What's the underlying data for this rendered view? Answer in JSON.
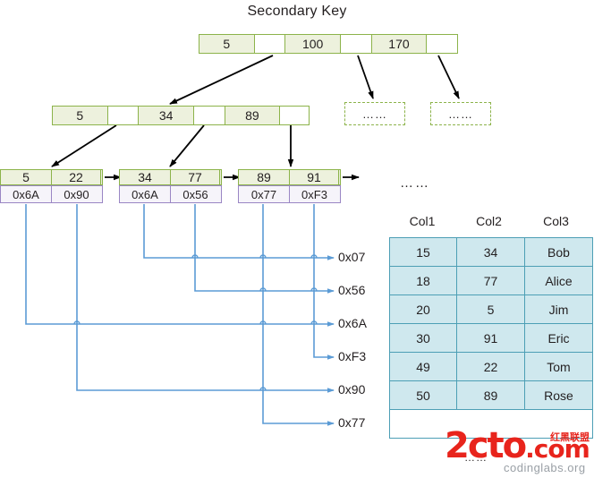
{
  "title": "Secondary Key",
  "colors": {
    "node_border": "#8cb34a",
    "node_fill": "#edf1dd",
    "pointer_border": "#9a86c4",
    "pointer_fill": "#f6f4fa",
    "table_border": "#4d9fb5",
    "table_fill": "#cfe8ee",
    "link_line": "#5b9bd5",
    "arrow": "#000000",
    "watermark": "#e8241c"
  },
  "tree": {
    "root": {
      "cells": [
        {
          "text": "5",
          "type": "key"
        },
        {
          "text": "",
          "type": "pointer"
        },
        {
          "text": "100",
          "type": "key"
        },
        {
          "text": "",
          "type": "pointer"
        },
        {
          "text": "170",
          "type": "key"
        },
        {
          "text": "",
          "type": "pointer"
        }
      ]
    },
    "internal": {
      "cells": [
        {
          "text": "5",
          "type": "key"
        },
        {
          "text": "",
          "type": "pointer"
        },
        {
          "text": "34",
          "type": "key"
        },
        {
          "text": "",
          "type": "pointer"
        },
        {
          "text": "89",
          "type": "key"
        },
        {
          "text": "",
          "type": "pointer"
        }
      ]
    },
    "placeholders": [
      {
        "text": "……"
      },
      {
        "text": "……"
      }
    ],
    "leaves": [
      {
        "keys": [
          "5",
          "22"
        ],
        "pointers": [
          "0x6A",
          "0x90"
        ]
      },
      {
        "keys": [
          "34",
          "77"
        ],
        "pointers": [
          "0x6A",
          "0x56"
        ]
      },
      {
        "keys": [
          "89",
          "91"
        ],
        "pointers": [
          "0x77",
          "0xF3"
        ]
      }
    ],
    "leaf_ellipsis": "……"
  },
  "addresses": [
    {
      "label": "0x07"
    },
    {
      "label": "0x56"
    },
    {
      "label": "0x6A"
    },
    {
      "label": "0xF3"
    },
    {
      "label": "0x90"
    },
    {
      "label": "0x77"
    }
  ],
  "data_table": {
    "headers": [
      "Col1",
      "Col2",
      "Col3"
    ],
    "rows": [
      [
        "15",
        "34",
        "Bob"
      ],
      [
        "18",
        "77",
        "Alice"
      ],
      [
        "20",
        "5",
        "Jim"
      ],
      [
        "30",
        "91",
        "Eric"
      ],
      [
        "49",
        "22",
        "Tom"
      ],
      [
        "50",
        "89",
        "Rose"
      ]
    ],
    "trailing_row": "……"
  },
  "watermark": {
    "main": "2cto",
    "tld": ".com",
    "cn": "红黑联盟",
    "sub": "codinglabs.org",
    "dots": "……"
  }
}
